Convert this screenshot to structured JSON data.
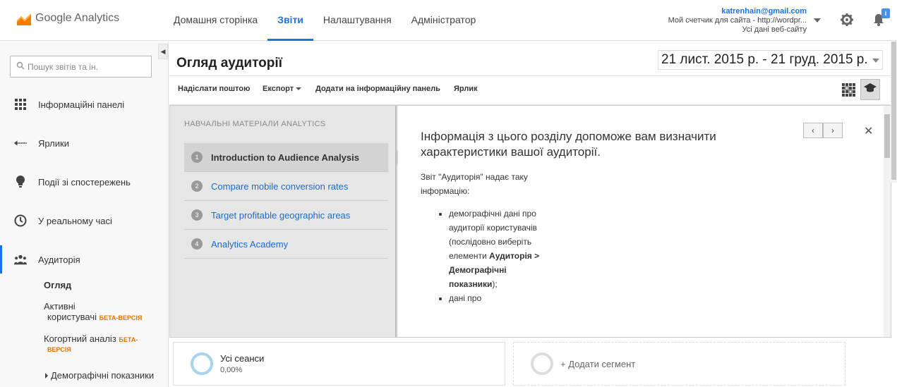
{
  "header": {
    "app_name": "Google Analytics",
    "nav": [
      {
        "label": "Домашня сторінка"
      },
      {
        "label": "Звіти"
      },
      {
        "label": "Налаштування"
      },
      {
        "label": "Адміністратор"
      }
    ],
    "account": {
      "email": "katrenhain@gmail.com",
      "property": "Мой счетчик для сайта - http://wordpr...",
      "view": "Усі дані веб-сайту"
    },
    "notification_badge": "i"
  },
  "sidebar": {
    "search_placeholder": "Пошук звітів та ін.",
    "items": [
      {
        "label": "Інформаційні панелі",
        "icon": "grid-icon"
      },
      {
        "label": "Ярлики",
        "icon": "shortcut-arrow-icon"
      },
      {
        "label": "Події зі спостережень",
        "icon": "lightbulb-icon"
      },
      {
        "label": "У реальному часі",
        "icon": "clock-icon"
      },
      {
        "label": "Аудиторія",
        "icon": "people-icon"
      }
    ],
    "sub_items": [
      {
        "label": "Огляд"
      },
      {
        "label": "Активні",
        "label2": "користувачі",
        "badge": "БЕТА-ВЕРСІЯ"
      },
      {
        "label": "Когортний аналіз",
        "badge1": "БЕТА-",
        "badge2": "ВЕРСІЯ"
      },
      {
        "label": "Демографічні показники"
      }
    ]
  },
  "main": {
    "title": "Огляд аудиторії",
    "date_range": "21 лист. 2015 р. - 21 груд. 2015 р.",
    "toolbar": {
      "email": "Надіслати поштою",
      "export": "Експорт",
      "add_dashboard": "Додати на інформаційну панель",
      "shortcut": "Ярлик"
    },
    "learning": {
      "heading": "НАВЧАЛЬНІ МАТЕРІАЛИ ANALYTICS",
      "lessons": [
        {
          "num": "1",
          "label": "Introduction to Audience Analysis"
        },
        {
          "num": "2",
          "label": "Compare mobile conversion rates"
        },
        {
          "num": "3",
          "label": "Target profitable geographic areas"
        },
        {
          "num": "4",
          "label": "Analytics Academy"
        }
      ],
      "content_title": "Інформація з цього розділу допоможе вам визначити характеристики вашої аудиторії.",
      "content_intro": "Звіт \"Аудиторія\" надає таку інформацію:",
      "bullet1_text": "демографічні дані про аудиторії користувачів (послідовно виберіть елементи",
      "bullet1_bold": "Аудиторія > Демографічні показники",
      "bullet1_end": ");",
      "bullet2_text": "дані про"
    },
    "segments": [
      {
        "name": "Усі сеанси",
        "value": "0,00%"
      },
      {
        "name": "+ Додати сегмент"
      }
    ]
  }
}
